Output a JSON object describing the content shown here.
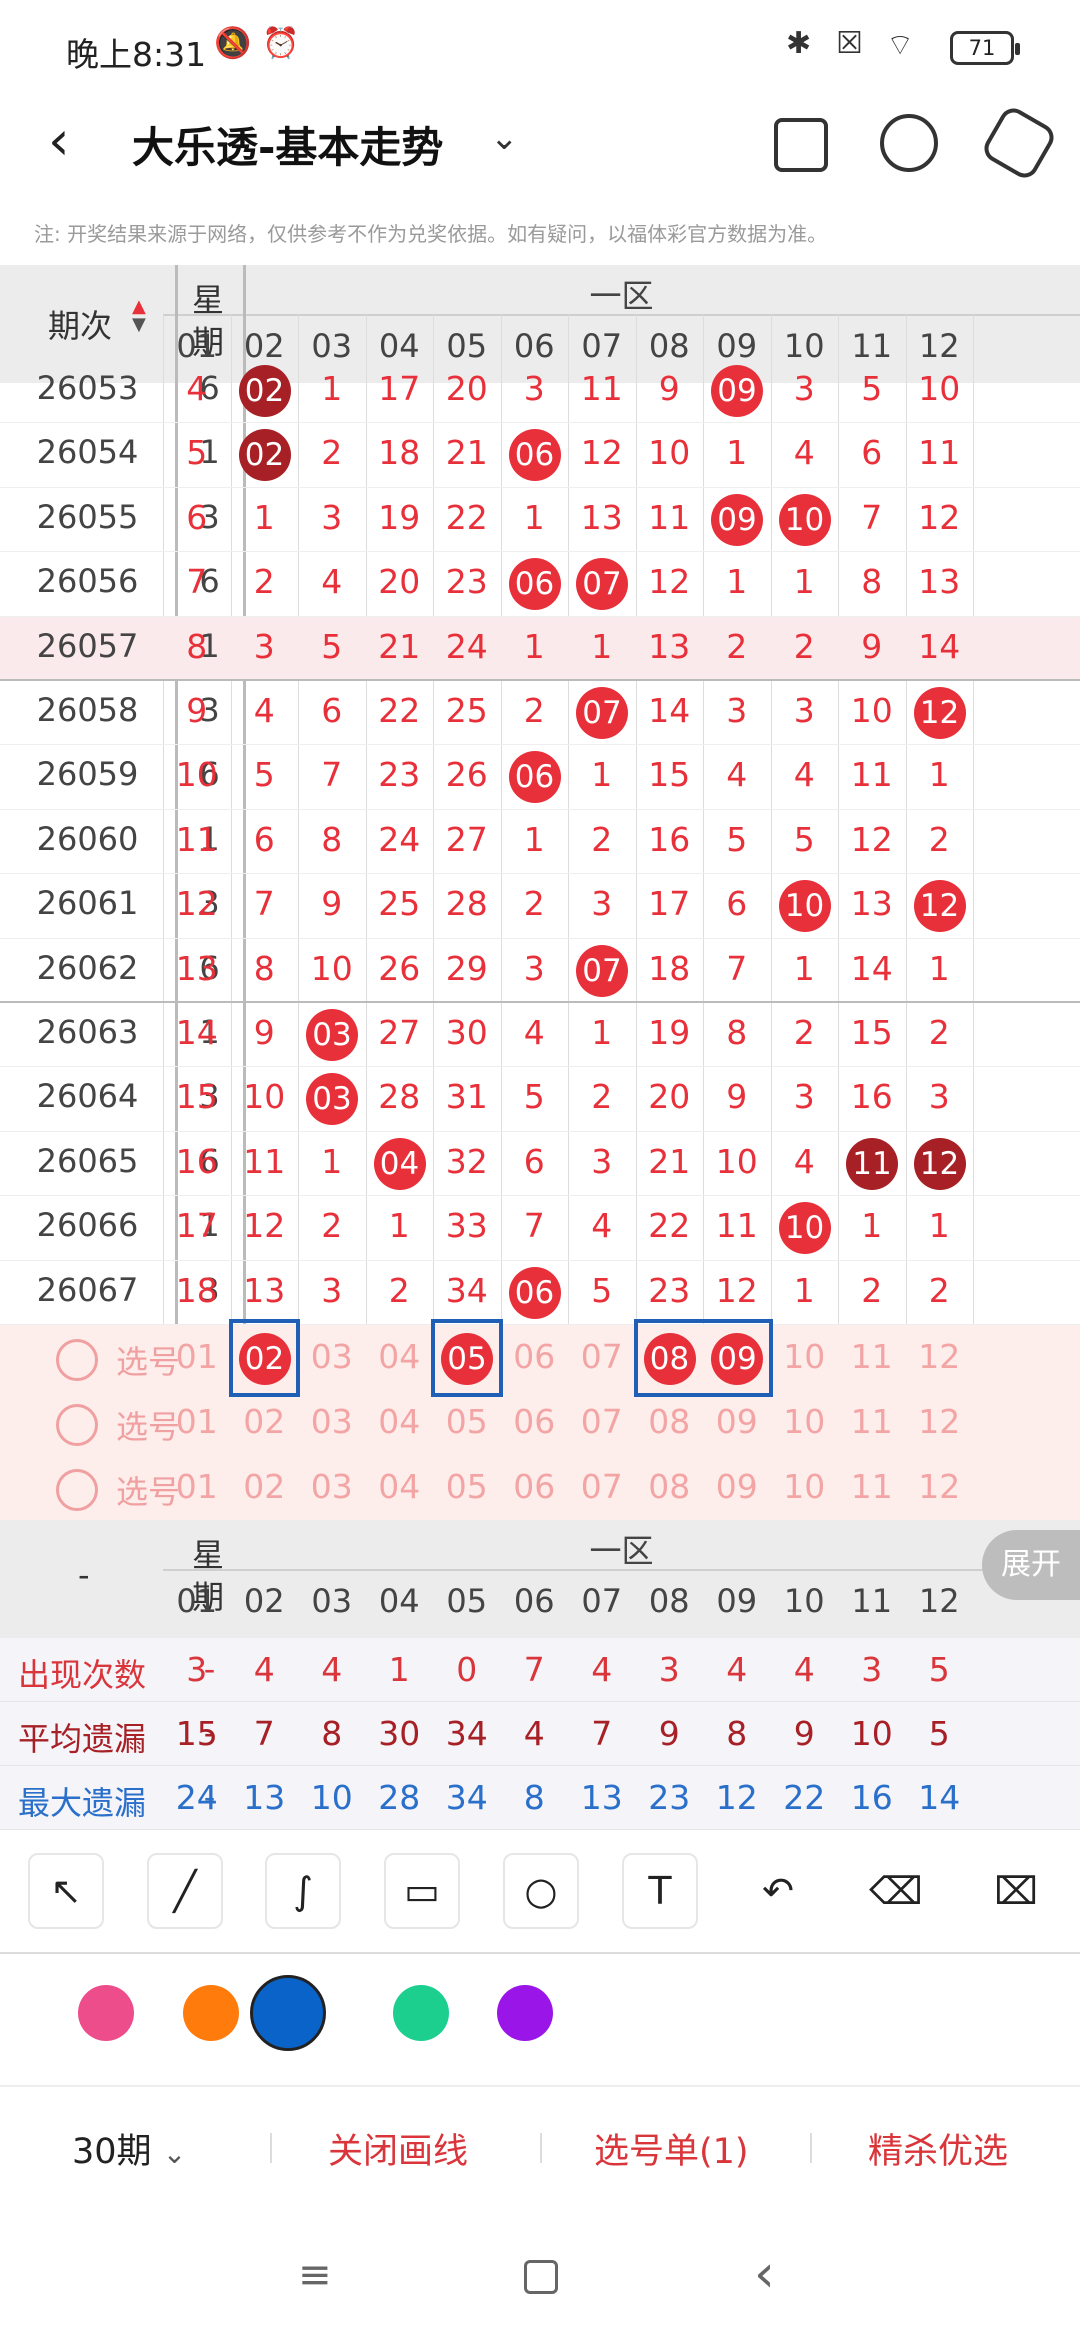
{
  "status": {
    "time": "晚上8:31",
    "battery": "71"
  },
  "header": {
    "title": "大乐透-基本走势"
  },
  "notice": "注: 开奖结果来源于网络，仅供参考不作为兑奖依据。如有疑问，以福体彩官方数据为准。",
  "grid": {
    "head_issue": "期次",
    "head_week": "星期",
    "zone_label": "一区",
    "columns": [
      "01",
      "02",
      "03",
      "04",
      "05",
      "06",
      "07",
      "08",
      "09",
      "10",
      "11",
      "12"
    ],
    "rows": [
      {
        "issue": "26053",
        "week": "6",
        "cells": [
          "4",
          "02",
          "1",
          "17",
          "20",
          "3",
          "11",
          "9",
          "09",
          "3",
          "5",
          "10"
        ],
        "hits": [
          1,
          8
        ]
      },
      {
        "issue": "26054",
        "week": "1",
        "cells": [
          "5",
          "02",
          "2",
          "18",
          "21",
          "06",
          "12",
          "10",
          "1",
          "4",
          "6",
          "11"
        ],
        "hits": [
          1,
          5
        ]
      },
      {
        "issue": "26055",
        "week": "3",
        "cells": [
          "6",
          "1",
          "3",
          "19",
          "22",
          "1",
          "13",
          "11",
          "09",
          "10",
          "7",
          "12"
        ],
        "hits": [
          8,
          9
        ]
      },
      {
        "issue": "26056",
        "week": "6",
        "cells": [
          "7",
          "2",
          "4",
          "20",
          "23",
          "06",
          "07",
          "12",
          "1",
          "1",
          "8",
          "13"
        ],
        "hits": [
          5,
          6
        ]
      },
      {
        "issue": "26057",
        "week": "1",
        "cells": [
          "8",
          "3",
          "5",
          "21",
          "24",
          "1",
          "1",
          "13",
          "2",
          "2",
          "9",
          "14"
        ],
        "hits": []
      },
      {
        "issue": "26058",
        "week": "3",
        "cells": [
          "9",
          "4",
          "6",
          "22",
          "25",
          "2",
          "07",
          "14",
          "3",
          "3",
          "10",
          "12"
        ],
        "hits": [
          6,
          11
        ]
      },
      {
        "issue": "26059",
        "week": "6",
        "cells": [
          "10",
          "5",
          "7",
          "23",
          "26",
          "06",
          "1",
          "15",
          "4",
          "4",
          "11",
          "1"
        ],
        "hits": [
          5
        ]
      },
      {
        "issue": "26060",
        "week": "1",
        "cells": [
          "11",
          "6",
          "8",
          "24",
          "27",
          "1",
          "2",
          "16",
          "5",
          "5",
          "12",
          "2"
        ],
        "hits": []
      },
      {
        "issue": "26061",
        "week": "3",
        "cells": [
          "12",
          "7",
          "9",
          "25",
          "28",
          "2",
          "3",
          "17",
          "6",
          "10",
          "13",
          "12"
        ],
        "hits": [
          9,
          11
        ]
      },
      {
        "issue": "26062",
        "week": "6",
        "cells": [
          "13",
          "8",
          "10",
          "26",
          "29",
          "3",
          "07",
          "18",
          "7",
          "1",
          "14",
          "1"
        ],
        "hits": [
          6
        ]
      },
      {
        "issue": "26063",
        "week": "1",
        "cells": [
          "14",
          "9",
          "03",
          "27",
          "30",
          "4",
          "1",
          "19",
          "8",
          "2",
          "15",
          "2"
        ],
        "hits": [
          2
        ]
      },
      {
        "issue": "26064",
        "week": "3",
        "cells": [
          "15",
          "10",
          "03",
          "28",
          "31",
          "5",
          "2",
          "20",
          "9",
          "3",
          "16",
          "3"
        ],
        "hits": [
          2
        ]
      },
      {
        "issue": "26065",
        "week": "6",
        "cells": [
          "16",
          "11",
          "1",
          "04",
          "32",
          "6",
          "3",
          "21",
          "10",
          "4",
          "11",
          "12"
        ],
        "hits": [
          3,
          10,
          11
        ]
      },
      {
        "issue": "26066",
        "week": "1",
        "cells": [
          "17",
          "12",
          "2",
          "1",
          "33",
          "7",
          "4",
          "22",
          "11",
          "10",
          "1",
          "1"
        ],
        "hits": [
          9
        ]
      },
      {
        "issue": "26067",
        "week": "3",
        "cells": [
          "18",
          "13",
          "3",
          "2",
          "34",
          "06",
          "5",
          "23",
          "12",
          "1",
          "2",
          "2"
        ],
        "hits": [
          5
        ]
      }
    ],
    "pick_label": "选号",
    "pick_rows": [
      {
        "cells": [
          "01",
          "02",
          "03",
          "04",
          "05",
          "06",
          "07",
          "08",
          "09",
          "10",
          "11",
          "12"
        ],
        "selected": [
          1,
          4,
          7,
          8
        ]
      },
      {
        "cells": [
          "01",
          "02",
          "03",
          "04",
          "05",
          "06",
          "07",
          "08",
          "09",
          "10",
          "11",
          "12"
        ],
        "selected": []
      },
      {
        "cells": [
          "01",
          "02",
          "03",
          "04",
          "05",
          "06",
          "07",
          "08",
          "09",
          "10",
          "11",
          "12"
        ],
        "selected": []
      }
    ],
    "stats_dash": "-",
    "stats": [
      {
        "label": "出现次数",
        "dash": "-",
        "values": [
          "3",
          "4",
          "4",
          "1",
          "0",
          "7",
          "4",
          "3",
          "4",
          "4",
          "3",
          "5"
        ]
      },
      {
        "label": "平均遗漏",
        "dash": "-",
        "values": [
          "15",
          "7",
          "8",
          "30",
          "34",
          "4",
          "7",
          "9",
          "8",
          "9",
          "10",
          "5"
        ]
      },
      {
        "label": "最大遗漏",
        "dash": "-",
        "values": [
          "24",
          "13",
          "10",
          "28",
          "34",
          "8",
          "13",
          "23",
          "12",
          "22",
          "16",
          "14"
        ]
      }
    ],
    "expand_label": "展开"
  },
  "colors": {
    "swatches": [
      "#ee4d8c",
      "#ff7b0c",
      "#0a63c9",
      "#1ccf8f",
      "#9a16e8"
    ],
    "hit": "#e8303a",
    "hit_dark": "#a62026"
  },
  "bottom": {
    "period": "30期",
    "close_lines": "关闭画线",
    "pick_list": "选号单(1)",
    "best": "精杀优选"
  }
}
